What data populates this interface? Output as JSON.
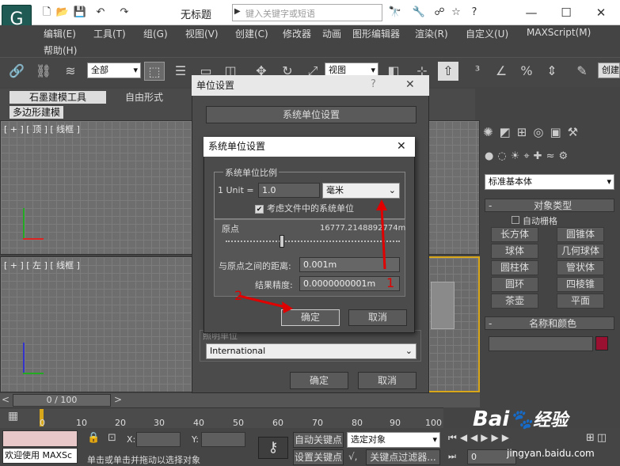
{
  "titlebar": {
    "title": "无标题",
    "search_placeholder": "键入关键字或短语",
    "minimize": "—",
    "maximize": "☐",
    "close": "✕"
  },
  "menus": [
    "编辑(E)",
    "工具(T)",
    "组(G)",
    "视图(V)",
    "创建(C)",
    "修改器",
    "动画",
    "图形编辑器",
    "渲染(R)",
    "自定义(U)",
    "MAXScript(M)",
    "帮助(H)"
  ],
  "toolbar": {
    "selection_filter": "全部",
    "ref_coord": "视图",
    "create_selection": "创建"
  },
  "ribbon": {
    "tabs": [
      "石墨建模工具",
      "自由形式"
    ],
    "subtab": "多边形建模"
  },
  "viewports": {
    "top": "[ + ] [ 顶 ] [ 线框 ]",
    "left": "[ + ] [ 左 ] [ 线框 ]"
  },
  "timeline": {
    "frame": "0 / 100",
    "ticks": [
      "0",
      "10",
      "20",
      "30",
      "40",
      "50",
      "60",
      "70",
      "80",
      "90",
      "100"
    ]
  },
  "status": {
    "script_text": "欢迎使用 MAXSc",
    "x_label": "X:",
    "y_label": "Y:",
    "hint": "单击或单击并拖动以选择对象",
    "auto_key": "自动关键点",
    "set_key": "设置关键点",
    "selected_object": "选定对象",
    "key_filter": "关键点过滤器...",
    "frame_value": "0"
  },
  "right_panel": {
    "category": "标准基本体",
    "object_type_header": "对象类型",
    "autogrid": "自动栅格",
    "buttons": [
      "长方体",
      "圆锥体",
      "球体",
      "几何球体",
      "圆柱体",
      "管状体",
      "圆环",
      "四棱锥",
      "茶壶",
      "平面"
    ],
    "name_color_header": "名称和颜色"
  },
  "unit_setup": {
    "title": "单位设置",
    "help": "?",
    "close": "✕",
    "system_unit_button": "系统单位设置",
    "lighting_label": "照明单位",
    "lighting_value": "International",
    "ok": "确定",
    "cancel": "取消"
  },
  "system_unit_setup": {
    "title": "系统单位设置",
    "close": "✕",
    "scale_group": "系统单位比例",
    "unit_label": "1 Unit =",
    "unit_value": "1.0",
    "unit_type": "毫米",
    "respect_checkbox": "考虑文件中的系统单位",
    "respect_checked": true,
    "origin_label": "原点",
    "origin_value": "16777.2148892774m",
    "distance_label": "与原点之间的距离:",
    "distance_value": "0.001m",
    "precision_label": "结果精度:",
    "precision_value": "0.0000000001m",
    "ok": "确定",
    "cancel": "取消"
  },
  "annotations": {
    "marker1": "1",
    "marker2": "2"
  },
  "watermark": {
    "brand": "Bai",
    "brand2": "经验",
    "url": "jingyan.baidu.com"
  },
  "colors": {
    "accent_red": "#e00000",
    "swatch": "#9a1030"
  }
}
